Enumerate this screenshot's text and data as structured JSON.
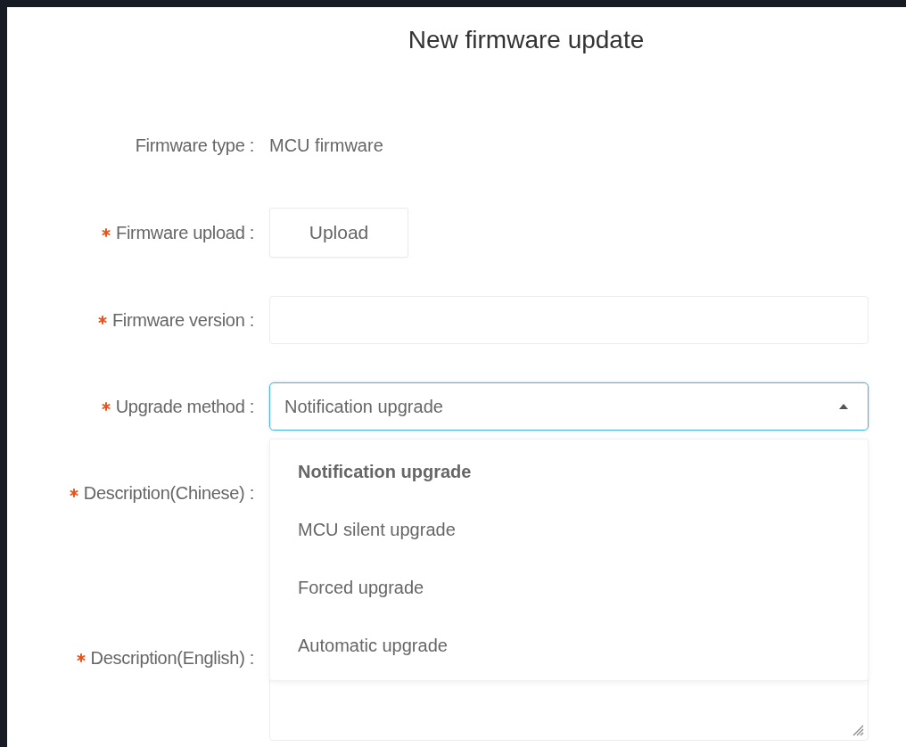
{
  "title": "New firmware update",
  "fields": [
    {
      "kind": "static",
      "label": "Firmware type :",
      "required": false,
      "value": "MCU firmware"
    },
    {
      "kind": "upload",
      "label": "Firmware upload :",
      "required": true,
      "button": "Upload"
    },
    {
      "kind": "text",
      "label": "Firmware version :",
      "required": true
    },
    {
      "kind": "select",
      "label": "Upgrade method :",
      "required": true,
      "value": "Notification upgrade",
      "expanded": true,
      "options": [
        {
          "label": "Notification upgrade",
          "selected": true
        },
        {
          "label": "MCU silent upgrade",
          "selected": false
        },
        {
          "label": "Forced upgrade",
          "selected": false
        },
        {
          "label": "Automatic upgrade",
          "selected": false
        }
      ]
    },
    {
      "kind": "textarea",
      "label": "Description(Chinese) :",
      "required": true,
      "covered": true
    },
    {
      "kind": "textarea",
      "label": "Description(English) :",
      "required": true,
      "covered": false
    }
  ]
}
